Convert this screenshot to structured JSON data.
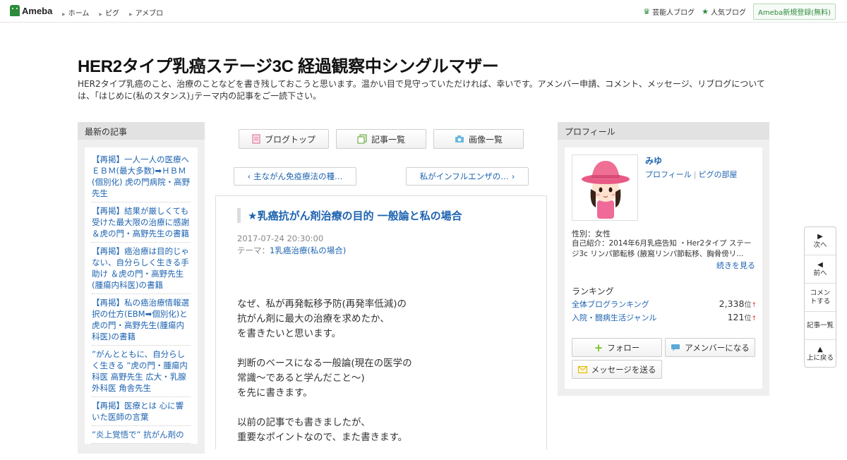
{
  "topbar": {
    "logo": "Ameba",
    "nav": [
      "ホーム",
      "ピグ",
      "アメブロ"
    ],
    "celebrity_blog": "芸能人ブログ",
    "popular_blog": "人気ブログ",
    "register": "Ameba新規登録(無料)"
  },
  "header": {
    "title": "HER2タイプ乳癌ステージ3C 経過観察中シングルマザー",
    "description": "HER2タイプ乳癌のこと、治療のことなどを書き残しておこうと思います。温かい目で見守っていただければ、幸いです。アメンバー申請、コメント、メッセージ、リブログについては、｢はじめに(私のスタンス)｣テーマ内の記事をご一読下さい。"
  },
  "left_sidebar": {
    "heading": "最新の記事",
    "items": [
      "【再掲】一人一人の医療へ ＥＢＭ(最大多数)➡ＨＢＭ(個別化) 虎の門病院・高野先生",
      "【再掲】結果が厳しくても受けた最大限の治療に感謝 ＆虎の門・高野先生の書籍",
      "【再掲】癌治療は目的じゃない、自分らしく生きる手助け ＆虎の門・高野先生(腫瘍内科医)の書籍",
      "【再掲】私の癌治療情報選択の仕方(EBM➡個別化)と虎の門・高野先生(腫瘍内科医)の書籍",
      "”がんとともに、自分らしく生きる ”虎の門・腫瘍内科医 高野先生 広大・乳腺外科医 角舎先生",
      "【再掲】医療とは 心に響いた医師の言葉",
      "”炎上覚悟で” 抗がん剤の"
    ]
  },
  "tabs": [
    "ブログトップ",
    "記事一覧",
    "画像一覧"
  ],
  "pager": {
    "prev": "主ながん免疫療法の種…",
    "next": "私がインフルエンザの…"
  },
  "article": {
    "title": "★乳癌抗がん剤治療の目的 一般論と私の場合",
    "date": "2017-07-24 20:30:00",
    "theme_label": "テーマ：",
    "theme": "1乳癌治療(私の場合)",
    "paragraphs": [
      [
        "なぜ、私が再発転移予防(再発率低減)の",
        "抗がん剤に最大の治療を求めたか、",
        "を書きたいと思います。"
      ],
      [
        "判断のベースになる一般論(現在の医学の",
        "常識～であると学んだこと～)",
        "を先に書きます。"
      ],
      [
        "以前の記事でも書きましたが、",
        "重要なポイントなので、また書きます。"
      ]
    ]
  },
  "right_sidebar": {
    "heading": "プロフィール",
    "name": "みゆ",
    "profile_link": "プロフィール",
    "pig_link": "ピグの部屋",
    "gender": "性別：女性",
    "intro": "自己紹介：2014年6月乳癌告知 ・Her2タイプ ステージ3c リンパ節転移 (腋窩リンパ節転移、胸骨傍リ...",
    "more": "続きを見る",
    "ranking_heading": "ランキング",
    "rankings": [
      {
        "label": "全体ブログランキング",
        "value": "2,338",
        "unit": "位",
        "arrow": "↑"
      },
      {
        "label": "入院・闘病生活ジャンル",
        "value": "121",
        "unit": "位",
        "arrow": "↑"
      }
    ],
    "follow": "フォロー",
    "amember": "アメンバーになる",
    "message": "メッセージを送る"
  },
  "float_nav": {
    "next": "次へ",
    "prev": "前へ",
    "comment": "コメントする",
    "list": "記事一覧",
    "top": "上に戻る"
  },
  "colors": {
    "link": "#1d63b0",
    "brand_green": "#2d8c3c",
    "sidebar_bg": "#efefef"
  }
}
